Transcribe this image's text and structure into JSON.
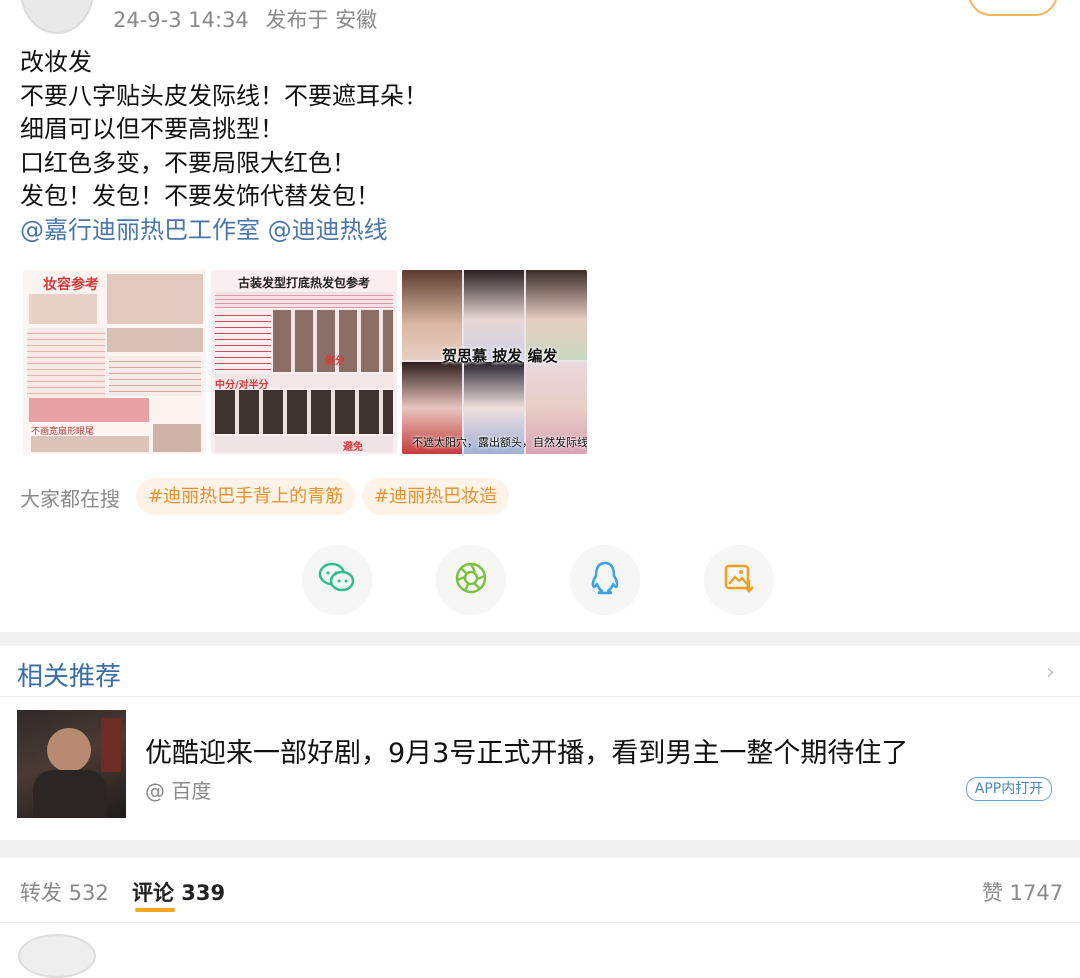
{
  "header": {
    "timestamp": "24-9-3 14:34",
    "location": "发布于 安徽"
  },
  "post": {
    "lines": [
      "改妆发",
      "不要八字贴头皮发际线！不要遮耳朵！",
      "细眉可以但不要高挑型！",
      "口红色多变，不要局限大红色！",
      "发包！发包！不要发饰代替发包！"
    ],
    "mentions": [
      "@嘉行迪丽热巴工作室",
      "@迪迪热线"
    ]
  },
  "images": [
    {
      "title": "妆容参考",
      "note": "不画宽扇形眼尾"
    },
    {
      "title": "古装发型打底热发包参考",
      "labels": [
        "侧分",
        "中分/对半分",
        "避免"
      ]
    },
    {
      "caption": "贺思慕 披发 编发",
      "footer": "不遮太阳穴，露出额头，自然发际线"
    }
  ],
  "search": {
    "label": "大家都在搜",
    "chips": [
      "#迪丽热巴手背上的青筋",
      "#迪丽热巴妆造"
    ]
  },
  "share_icons": [
    "wechat-icon",
    "moments-icon",
    "qq-icon",
    "save-image-icon"
  ],
  "related": {
    "title": "相关推荐",
    "item": {
      "title": "优酷迎来一部好剧，9月3号正式开播，看到男主一整个期待住了",
      "source": "@ 百度",
      "open_label": "APP内打开"
    }
  },
  "tabs": {
    "repost": "转发 532",
    "comments": "评论 339",
    "likes": "赞 1747"
  },
  "colors": {
    "accent": "#f5a623",
    "link": "#4a76a8",
    "chip_bg": "#fdf3e8",
    "chip_text": "#e8912e"
  }
}
